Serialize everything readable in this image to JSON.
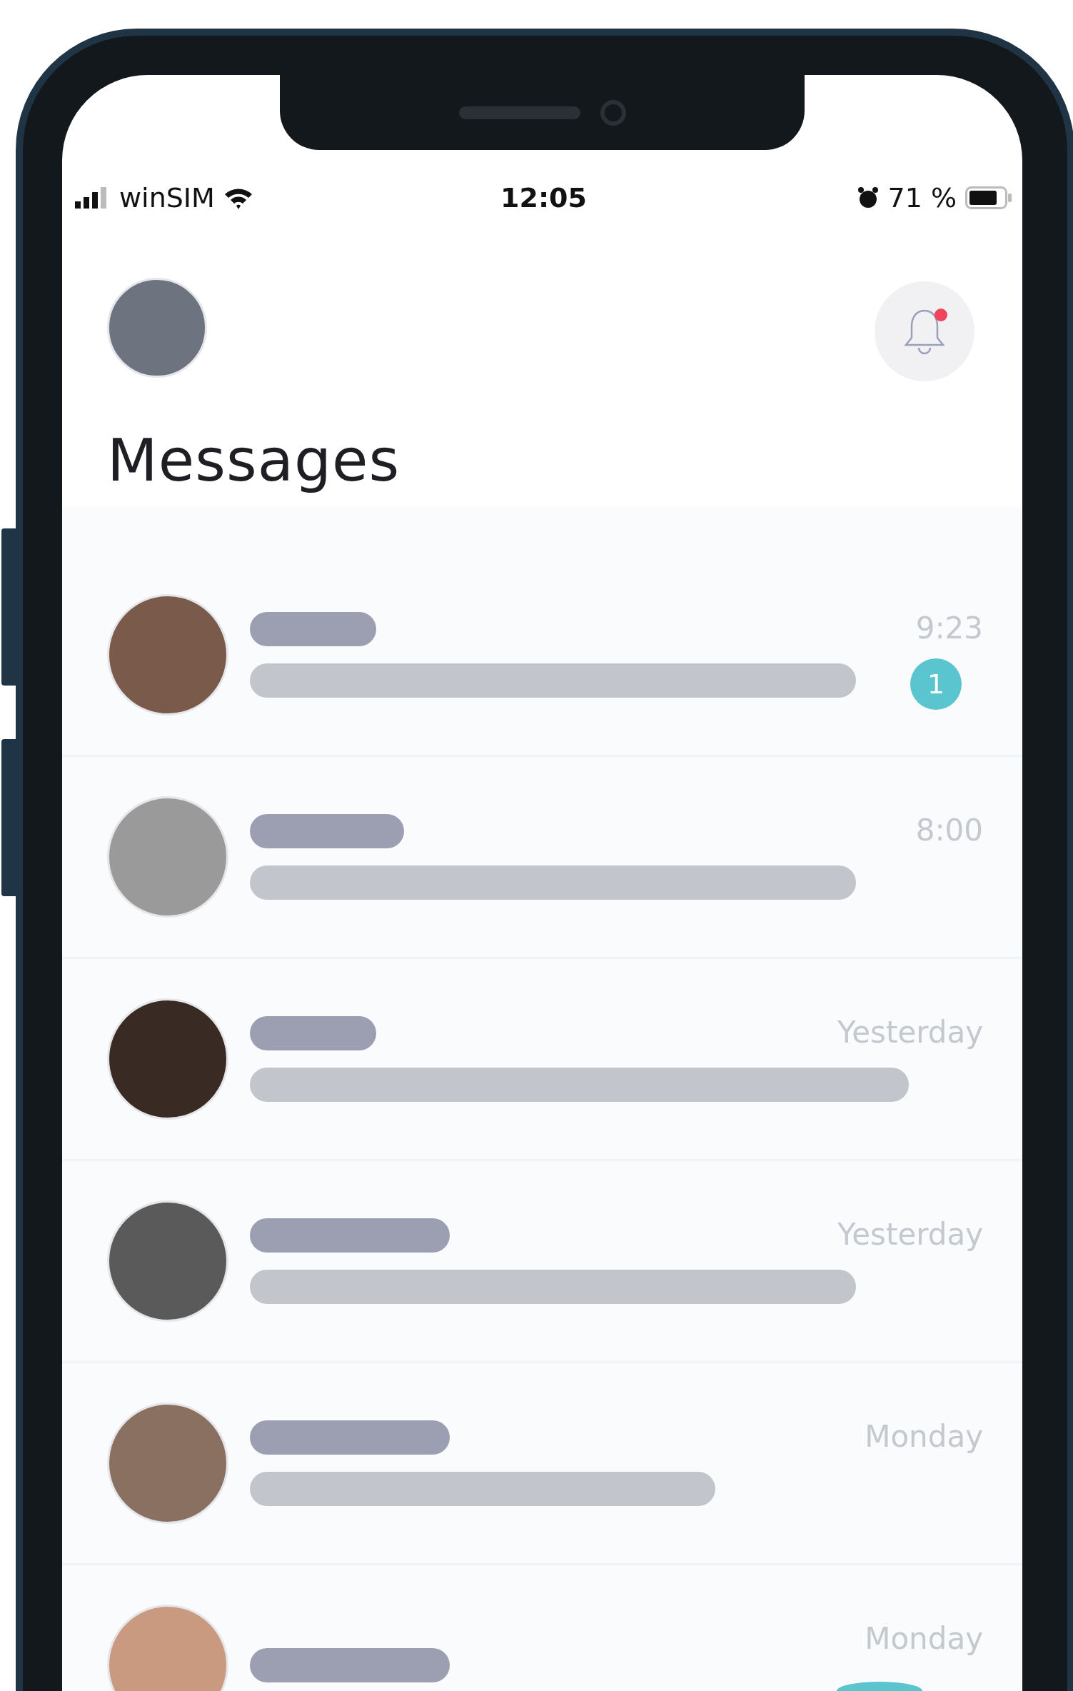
{
  "status_bar": {
    "carrier": "winSIM",
    "time": "12:05",
    "battery": "71 %"
  },
  "header": {
    "title": "Messages",
    "notification_unread": true
  },
  "conversations": [
    {
      "time": "9:23",
      "unread_count": "1"
    },
    {
      "time": "8:00"
    },
    {
      "time": "Yesterday"
    },
    {
      "time": "Yesterday"
    },
    {
      "time": "Monday"
    },
    {
      "time": "Monday"
    }
  ]
}
